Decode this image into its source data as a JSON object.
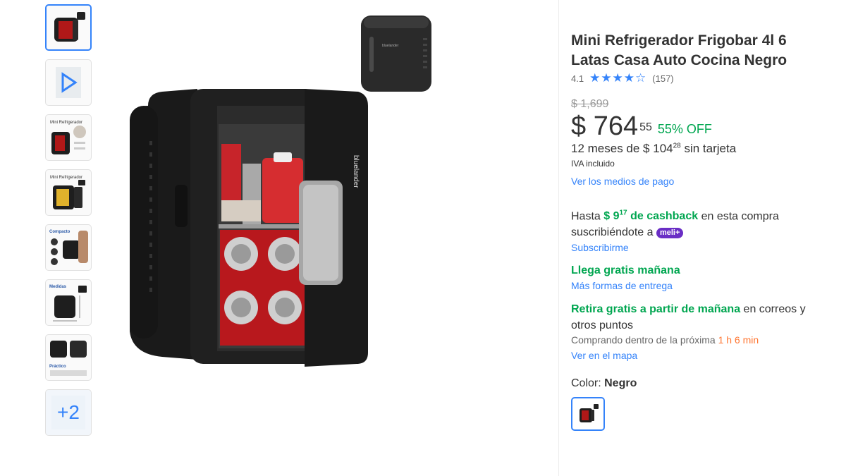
{
  "product": {
    "title": "Mini Refrigerador Frigobar 4l 6 Latas Casa Auto Cocina Negro",
    "rating": "4.1",
    "rating_stars": "★★★★☆",
    "rating_value": 4.1,
    "review_count": "(157)",
    "brand_on_image": "bluelander"
  },
  "pricing": {
    "old_price": "$ 1,699",
    "price_int": "$ 764",
    "price_cents": "55",
    "discount": "55% OFF",
    "installments_prefix": "12 meses de $ 104",
    "installments_cents": "28",
    "installments_suffix": " sin tarjeta",
    "iva": "IVA incluido",
    "payment_link": "Ver los medios de pago"
  },
  "cashback": {
    "prefix": "Hasta ",
    "amount_int": "$ 9",
    "amount_cents": "17",
    "label": " de cashback",
    "suffix": " en esta compra suscribiéndote a ",
    "badge": "meli+",
    "subscribe_link": "Subscribirme"
  },
  "shipping": {
    "title": "Llega gratis mañana",
    "link": "Más formas de entrega"
  },
  "pickup": {
    "title": "Retira gratis a partir de mañana",
    "suffix": " en correos y otros puntos",
    "countdown_prefix": "Comprando dentro de la próxima ",
    "countdown_time": "1 h 6 min",
    "map_link": "Ver en el mapa"
  },
  "variant": {
    "label": "Color: ",
    "value": "Negro"
  },
  "thumbnails": {
    "more_label": "+2",
    "thumb2_title": "Mini Refrigerador",
    "thumb5_title": "Compacto",
    "thumb6_title": "Medidas",
    "thumb7_title": "Práctico"
  },
  "colors": {
    "accent": "#3483fa",
    "green": "#00a650",
    "orange": "#ff7733",
    "meli_purple": "#6a2ec5"
  }
}
